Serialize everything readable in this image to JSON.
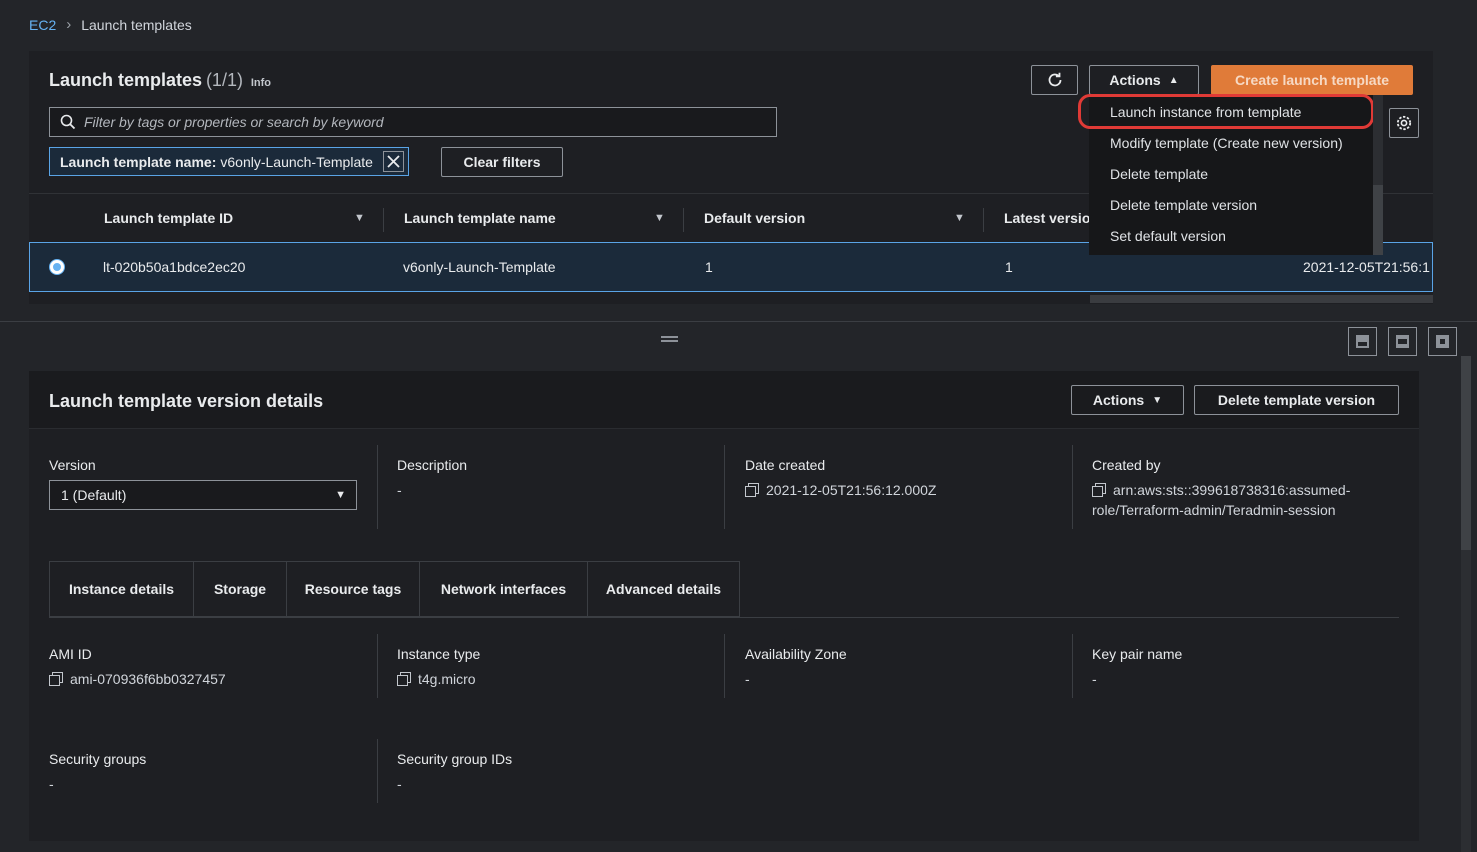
{
  "breadcrumb": {
    "root": "EC2",
    "current": "Launch templates"
  },
  "templates": {
    "title": "Launch templates",
    "count": "(1/1)",
    "info": "Info",
    "actions_label": "Actions",
    "create_label": "Create launch template",
    "search_placeholder": "Filter by tags or properties or search by keyword",
    "filter_token": {
      "key": "Launch template name:",
      "value": "v6only-Launch-Template"
    },
    "clear_filters": "Clear filters",
    "columns": [
      "Launch template ID",
      "Launch template name",
      "Default version",
      "Latest version"
    ],
    "row": {
      "id": "lt-020b50a1bdce2ec20",
      "name": "v6only-Launch-Template",
      "default_version": "1",
      "latest_version": "1",
      "created": "2021-12-05T21:56:1"
    }
  },
  "actions_menu": [
    "Launch instance from template",
    "Modify template (Create new version)",
    "Delete template",
    "Delete template version",
    "Set default version"
  ],
  "details": {
    "title": "Launch template version details",
    "actions_label": "Actions",
    "delete_label": "Delete template version",
    "version_label": "Version",
    "version_value": "1 (Default)",
    "description_label": "Description",
    "description_value": "-",
    "date_label": "Date created",
    "date_value": "2021-12-05T21:56:12.000Z",
    "created_by_label": "Created by",
    "created_by_line1": "arn:aws:sts::399618738316:assumed-",
    "created_by_line2": "role/Terraform-admin/Teradmin-session",
    "tabs": [
      "Instance details",
      "Storage",
      "Resource tags",
      "Network interfaces",
      "Advanced details"
    ],
    "ami_label": "AMI ID",
    "ami_value": "ami-070936f6bb0327457",
    "instance_type_label": "Instance type",
    "instance_type_value": "t4g.micro",
    "az_label": "Availability Zone",
    "az_value": "-",
    "keypair_label": "Key pair name",
    "keypair_value": "-",
    "sg_label": "Security groups",
    "sg_value": "-",
    "sgid_label": "Security group IDs",
    "sgid_value": "-"
  },
  "colors": {
    "accent": "#e07b39",
    "link": "#66b2f2",
    "highlight": "#e03a36"
  }
}
